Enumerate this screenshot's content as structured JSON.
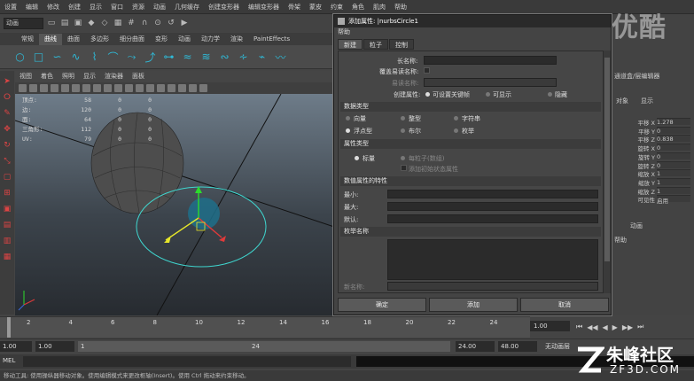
{
  "menubar": {
    "items": [
      "设置",
      "编辑",
      "修改",
      "创建",
      "显示",
      "窗口",
      "资源",
      "动画",
      "几何缓存",
      "创建变形器",
      "编辑变形器",
      "骨架",
      "蒙皮",
      "约束",
      "角色",
      "肌肉",
      "帮助"
    ]
  },
  "toolbar": {
    "mode": "动画"
  },
  "shelf": {
    "tabs": [
      "常规",
      "曲线",
      "曲面",
      "多边形",
      "细分曲面",
      "变形",
      "动画",
      "动力学",
      "渲染",
      "PaintEffects"
    ],
    "active_tab": "曲线"
  },
  "viewport": {
    "menu": [
      "视图",
      "着色",
      "照明",
      "显示",
      "渲染器",
      "面板"
    ],
    "hud": [
      {
        "label": "顶点:",
        "v1": "58",
        "v2": "0",
        "v3": "0"
      },
      {
        "label": "边:",
        "v1": "120",
        "v2": "0",
        "v3": "0"
      },
      {
        "label": "面:",
        "v1": "64",
        "v2": "0",
        "v3": "0"
      },
      {
        "label": "三角形:",
        "v1": "112",
        "v2": "0",
        "v3": "0"
      },
      {
        "label": "UV:",
        "v1": "79",
        "v2": "0",
        "v3": "0"
      }
    ]
  },
  "dialog": {
    "title": "添加属性: |nurbsCircle1",
    "menu": "帮助",
    "tabs": [
      "新建",
      "粒子",
      "控制"
    ],
    "long_name_label": "长名称:",
    "override_nice_label": "覆盖易读名称:",
    "nice_name_label": "易读名称:",
    "make_attr_label": "创建属性:",
    "make_attr_options": [
      "可设置关键帧",
      "可显示",
      "隐藏"
    ],
    "data_type_section": "数据类型",
    "data_types": [
      "向量",
      "整型",
      "字符串",
      "浮点型",
      "布尔",
      "枚举"
    ],
    "attr_type_section": "属性类型",
    "attr_types": [
      "标量",
      "每粒子(数组)"
    ],
    "add_initial_state": "添加初始状态属性",
    "numeric_section": "数值属性的特性",
    "min_label": "最小:",
    "max_label": "最大:",
    "default_label": "默认:",
    "enum_section": "枚举名称",
    "new_name_label": "新名称:",
    "buttons": [
      "确定",
      "添加",
      "取消"
    ]
  },
  "right_panel": {
    "header": "通道盒/层编辑器",
    "tabs": [
      "对象",
      "显示"
    ],
    "attrs": [
      {
        "name": "平移 X",
        "value": "1.278"
      },
      {
        "name": "平移 Y",
        "value": "0"
      },
      {
        "name": "平移 Z",
        "value": "0.838"
      },
      {
        "name": "旋转 X",
        "value": "0"
      },
      {
        "name": "旋转 Y",
        "value": "0"
      },
      {
        "name": "旋转 Z",
        "value": "0"
      },
      {
        "name": "缩放 X",
        "value": "1"
      },
      {
        "name": "缩放 Y",
        "value": "1"
      },
      {
        "name": "缩放 Z",
        "value": "1"
      },
      {
        "name": "可见性",
        "value": "启用"
      }
    ],
    "layer_tab": "动画",
    "help": "帮助"
  },
  "timeline": {
    "ticks": [
      "2",
      "4",
      "6",
      "8",
      "10",
      "12",
      "14",
      "16",
      "18",
      "20",
      "22",
      "24"
    ],
    "current_time": "1.00"
  },
  "range": {
    "start": "1.00",
    "start2": "1.00",
    "slider_start": "1",
    "slider_end": "24",
    "end": "24.00",
    "end2": "48.00",
    "anim_layer": "无动画层"
  },
  "command": {
    "label": "MEL"
  },
  "status": "移动工具: 使用操纵器移动对象。使用编辑模式来更改枢轴(Insert)。使用 Ctrl 拖动来约束移动。",
  "watermark": {
    "top": "优酷",
    "site": "朱峰社区",
    "url": "ZF3D.COM"
  },
  "colors": {
    "accent": "#2fb9d6",
    "dialog_bg": "#444444",
    "title_bar": "#2a2a2a"
  }
}
